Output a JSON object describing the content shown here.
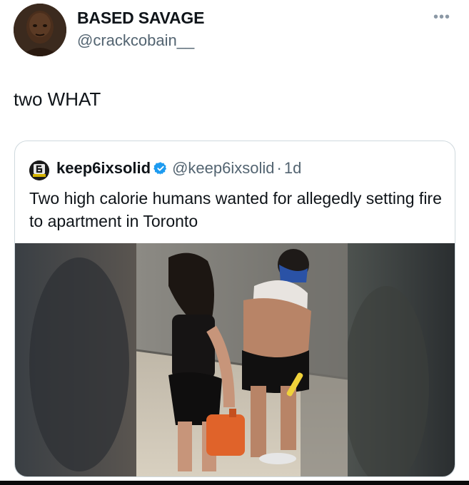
{
  "post": {
    "display_name": "BASED SAVAGE",
    "handle": "@crackcobain__",
    "more_label": "•••",
    "text": "two WHAT",
    "avatar_icon": "user-avatar"
  },
  "quote": {
    "display_name": "keep6ixsolid",
    "verified_icon": "verified-badge-icon",
    "verified_color": "#1d9bf0",
    "handle": "@keep6ixsolid",
    "separator": "·",
    "time": "1d",
    "text": "Two high calorie humans wanted for allegedly setting fire to apartment in Toronto",
    "media": "photo"
  },
  "colors": {
    "text_primary": "#0f1419",
    "text_secondary": "#536471",
    "border": "#cfd9de",
    "accent": "#1d9bf0"
  }
}
